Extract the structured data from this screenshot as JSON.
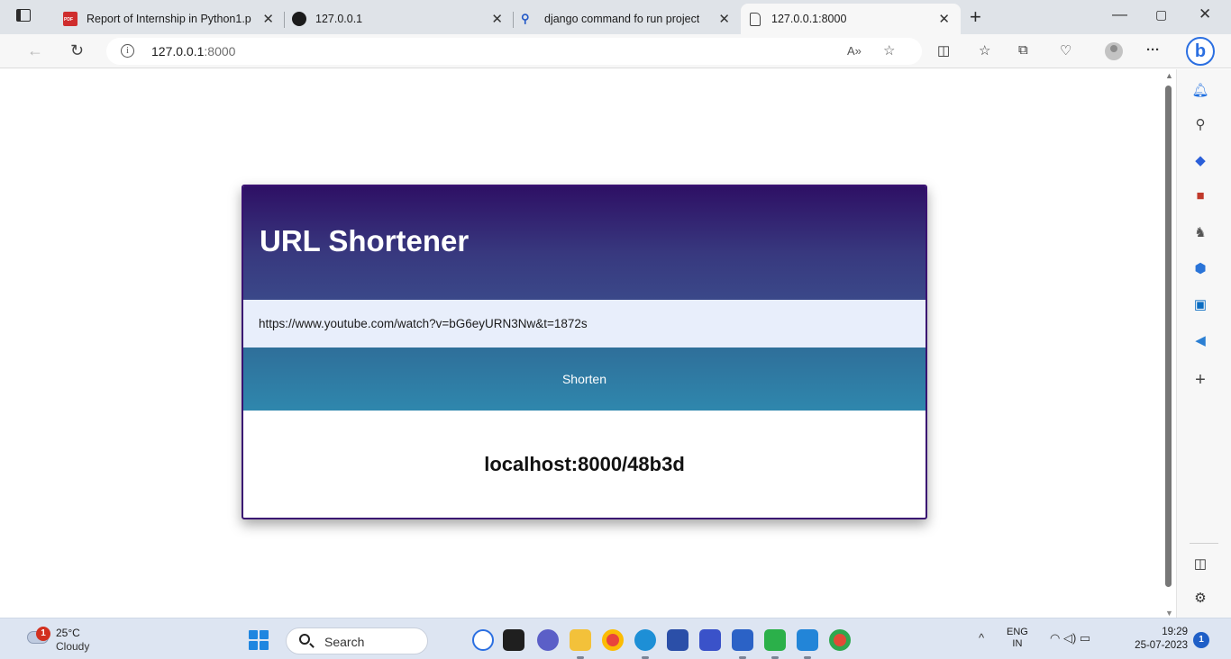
{
  "browser": {
    "tabs": [
      {
        "title": "Report of Internship in Python1.p",
        "favicon": "pdf-icon"
      },
      {
        "title": "127.0.0.1",
        "favicon": "github-icon"
      },
      {
        "title": "django command fo run project",
        "favicon": "search-icon"
      },
      {
        "title": "127.0.0.1:8000",
        "favicon": "page-icon",
        "active": true
      }
    ],
    "address": {
      "host": "127.0.0.1",
      "port": ":8000"
    }
  },
  "page": {
    "title": "URL Shortener",
    "input_value": "https://www.youtube.com/watch?v=bG6eyURN3Nw&t=1872s",
    "button_label": "Shorten",
    "result": "localhost:8000/48b3d"
  },
  "taskbar": {
    "weather": {
      "badge": "1",
      "temp": "25°C",
      "desc": "Cloudy"
    },
    "search_label": "Search",
    "language": {
      "line1": "ENG",
      "line2": "IN"
    },
    "clock": {
      "time": "19:29",
      "date": "25-07-2023"
    },
    "notification_count": "1"
  },
  "colors": {
    "header_top": "#2e1065",
    "header_bottom": "#3a4889",
    "input_bg": "#e8eefb",
    "button_bg": "#2f87ad"
  }
}
